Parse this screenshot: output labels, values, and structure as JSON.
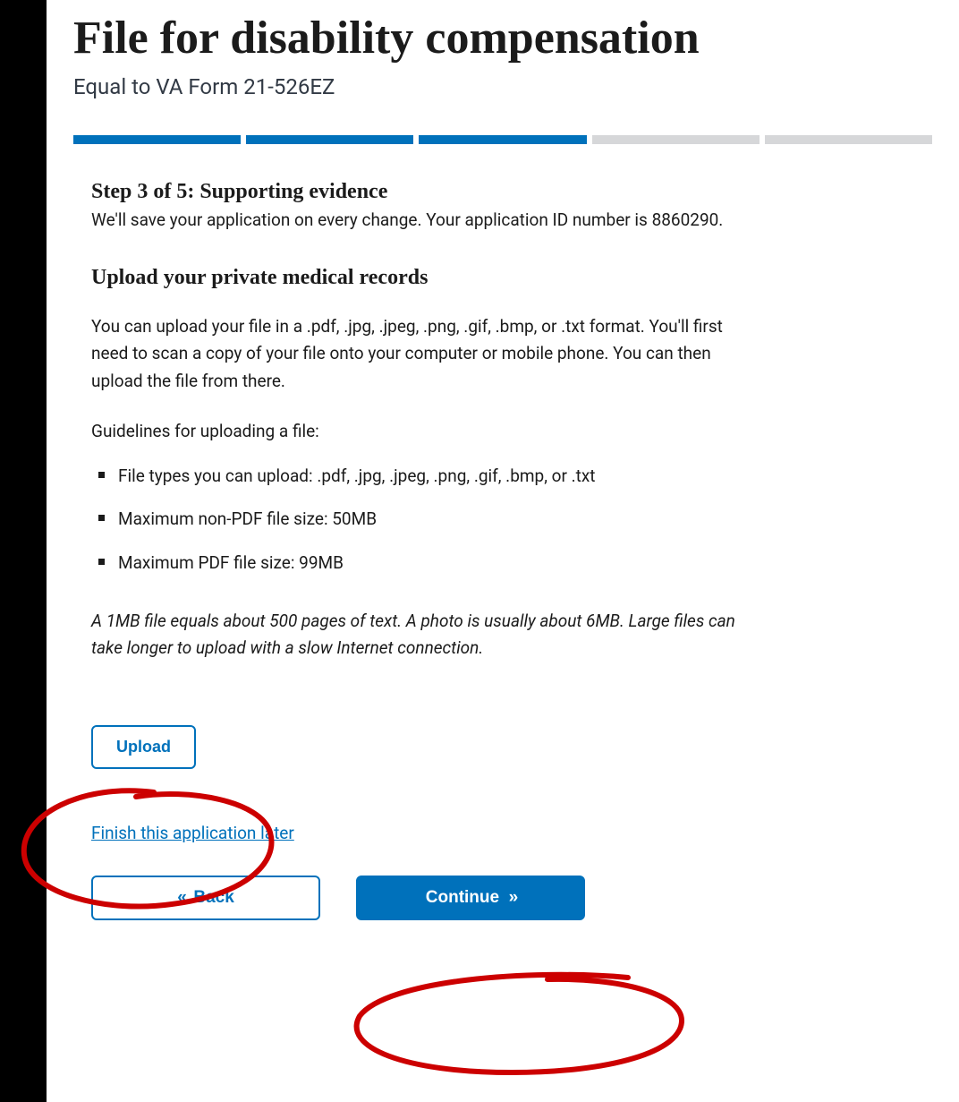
{
  "header": {
    "title": "File for disability compensation",
    "subtitle": "Equal to VA Form 21-526EZ"
  },
  "progress": {
    "total": 5,
    "completed": 3
  },
  "step": {
    "heading": "Step 3 of 5: Supporting evidence",
    "save_note": "We'll save your application on every change. Your application ID number is 8860290."
  },
  "section": {
    "heading": "Upload your private medical records",
    "intro": "You can upload your file in a .pdf, .jpg, .jpeg, .png, .gif, .bmp, or .txt format. You'll first need to scan a copy of your file onto your computer or mobile phone. You can then upload the file from there.",
    "guidelines_label": "Guidelines for uploading a file:",
    "guidelines": [
      "File types you can upload: .pdf, .jpg, .jpeg, .png, .gif, .bmp, or .txt",
      "Maximum non-PDF file size: 50MB",
      "Maximum PDF file size: 99MB"
    ],
    "note": "A 1MB file equals about 500 pages of text. A photo is usually about 6MB. Large files can take longer to upload with a slow Internet connection."
  },
  "actions": {
    "upload": "Upload",
    "finish_later": "Finish this application later",
    "back": "Back",
    "continue": "Continue"
  }
}
